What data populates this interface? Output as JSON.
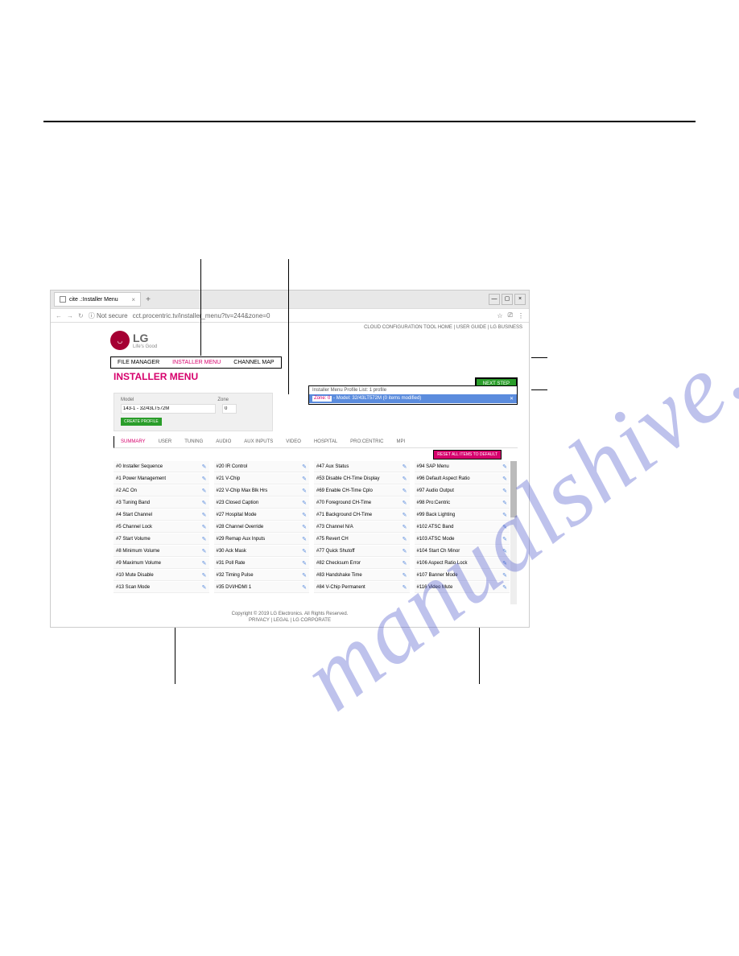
{
  "watermark": "manualshive.com",
  "browser": {
    "tabTitle": "cite .:Installer Menu",
    "url": "cct.procentric.tv/installer_menu?tv=244&zone=0",
    "notSecure": "Not secure"
  },
  "header": {
    "links": "CLOUD CONFIGURATION TOOL HOME  |  USER GUIDE  |  LG BUSINESS",
    "logoText": "LG",
    "logoSub": "Life's Good",
    "nav": [
      "FILE MANAGER",
      "INSTALLER MENU",
      "CHANNEL MAP"
    ],
    "pageTitle": "INSTALLER MENU"
  },
  "profile": {
    "modelLabel": "Model",
    "zoneLabel": "Zone",
    "modelValue": "143-1 - 32/43LT572M",
    "zoneValue": "0",
    "createBtn": "CREATE PROFILE"
  },
  "nextStep": "NEXT STEP",
  "profileList": {
    "header": "Installer Menu Profile List: 1 profile",
    "zoneLabel": "Zone: 0",
    "modelLabel": "Model: 32/43LT572M (0 items modified)"
  },
  "subtabs": [
    "SUMMARY",
    "USER",
    "TUNING",
    "AUDIO",
    "AUX INPUTS",
    "VIDEO",
    "HOSPITAL",
    "PRO:CENTRIC",
    "MPI"
  ],
  "resetBtn": "RESET ALL ITEMS TO DEFAULT",
  "columns": [
    [
      "#0 Installer Sequence",
      "#1 Power Management",
      "#2 AC On",
      "#3 Tuning Band",
      "#4 Start Channel",
      "#5 Channel Lock",
      "#7 Start Volume",
      "#8 Minimum Volume",
      "#9 Maximum Volume",
      "#10 Mute Disable",
      "#13 Scan Mode"
    ],
    [
      "#20 IR Control",
      "#21 V-Chip",
      "#22 V-Chip Max Blk Hrs",
      "#23 Closed Caption",
      "#27 Hospital Mode",
      "#28 Channel Override",
      "#29 Remap Aux Inputs",
      "#30 Ack Mask",
      "#31 Poll Rate",
      "#32 Timing Pulse",
      "#35 DVI/HDMI 1"
    ],
    [
      "#47 Aux Status",
      "#53 Disable CH-Time Display",
      "#69 Enable CH-Time Cplo",
      "#70 Foreground CH-Time",
      "#71 Background CH-Time",
      "#73 Channel N/A",
      "#75 Revert CH",
      "#77 Quick Shutoff",
      "#82 Checksum Error",
      "#83 Handshake Time",
      "#84 V-Chip Permanent"
    ],
    [
      "#94 SAP Menu",
      "#96 Default Aspect Ratio",
      "#97 Audio Output",
      "#98 Pro:Centric",
      "#99 Back Lighting",
      "#102 ATSC Band",
      "#103 ATSC Mode",
      "#104 Start Ch Minor",
      "#106 Aspect Ratio Lock",
      "#107 Banner Mode",
      "#116 Video Mute"
    ]
  ],
  "footer": {
    "line1": "Copyright © 2019 LG Electronics. All Rights Reserved.",
    "line2": "PRIVACY  |  LEGAL  |  LG CORPORATE"
  }
}
